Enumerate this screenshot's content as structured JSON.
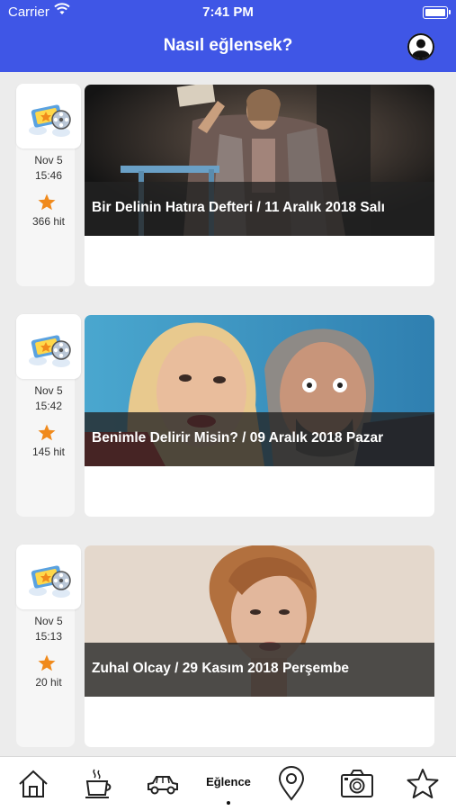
{
  "status_bar": {
    "carrier": "Carrier",
    "time": "7:41 PM"
  },
  "header": {
    "title": "Nasıl eğlensek?"
  },
  "feed": [
    {
      "date": "Nov 5",
      "time": "15:46",
      "hits": "366 hit",
      "caption": "Bir Delinin Hatıra Defteri / 11 Aralık 2018 Salı"
    },
    {
      "date": "Nov 5",
      "time": "15:42",
      "hits": "145 hit",
      "caption": "Benimle Delirir Misin? / 09 Aralık 2018 Pazar"
    },
    {
      "date": "Nov 5",
      "time": "15:13",
      "hits": "20 hit",
      "caption": "Zuhal Olcay / 29 Kasım 2018 Perşembe"
    }
  ],
  "tabbar": {
    "items": [
      "home-icon",
      "coffee-icon",
      "car-icon",
      "Eğlence",
      "location-pin-icon",
      "camera-icon",
      "star-icon"
    ],
    "active": "Eğlence"
  },
  "colors": {
    "header": "#3f56e6",
    "star": "#f08a1c"
  }
}
